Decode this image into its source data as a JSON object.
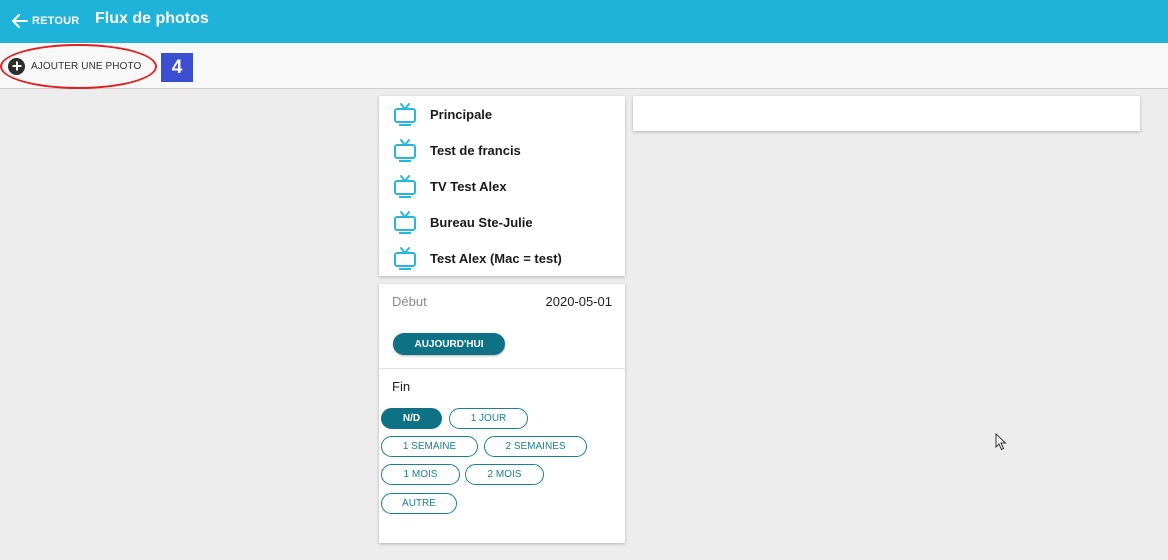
{
  "header": {
    "back_label": "RETOUR",
    "title": "Flux de photos"
  },
  "toolbar": {
    "add_photo_label": "AJOUTER UNE PHOTO",
    "step_number": "4"
  },
  "screens": {
    "items": [
      {
        "label": "Principale"
      },
      {
        "label": "Test de francis"
      },
      {
        "label": "TV Test Alex"
      },
      {
        "label": "Bureau Ste-Julie"
      },
      {
        "label": "Test Alex (Mac = test)"
      }
    ]
  },
  "dates": {
    "start_label": "Début",
    "start_value": "2020-05-01",
    "today_button": "AUJOURD'HUI",
    "end_label": "Fin",
    "end_options": [
      {
        "label": "N/D",
        "selected": true
      },
      {
        "label": "1 JOUR",
        "selected": false
      },
      {
        "label": "1 SEMAINE",
        "selected": false
      },
      {
        "label": "2 SEMAINES",
        "selected": false
      },
      {
        "label": "1 MOIS",
        "selected": false
      },
      {
        "label": "2 MOIS",
        "selected": false
      },
      {
        "label": "AUTRE",
        "selected": false
      }
    ]
  },
  "colors": {
    "header_bg": "#1fb3d9",
    "accent_teal": "#0f7186",
    "tv_icon": "#29b6d9",
    "annotation_red": "#e02020",
    "badge_blue": "#3b4fd0"
  }
}
